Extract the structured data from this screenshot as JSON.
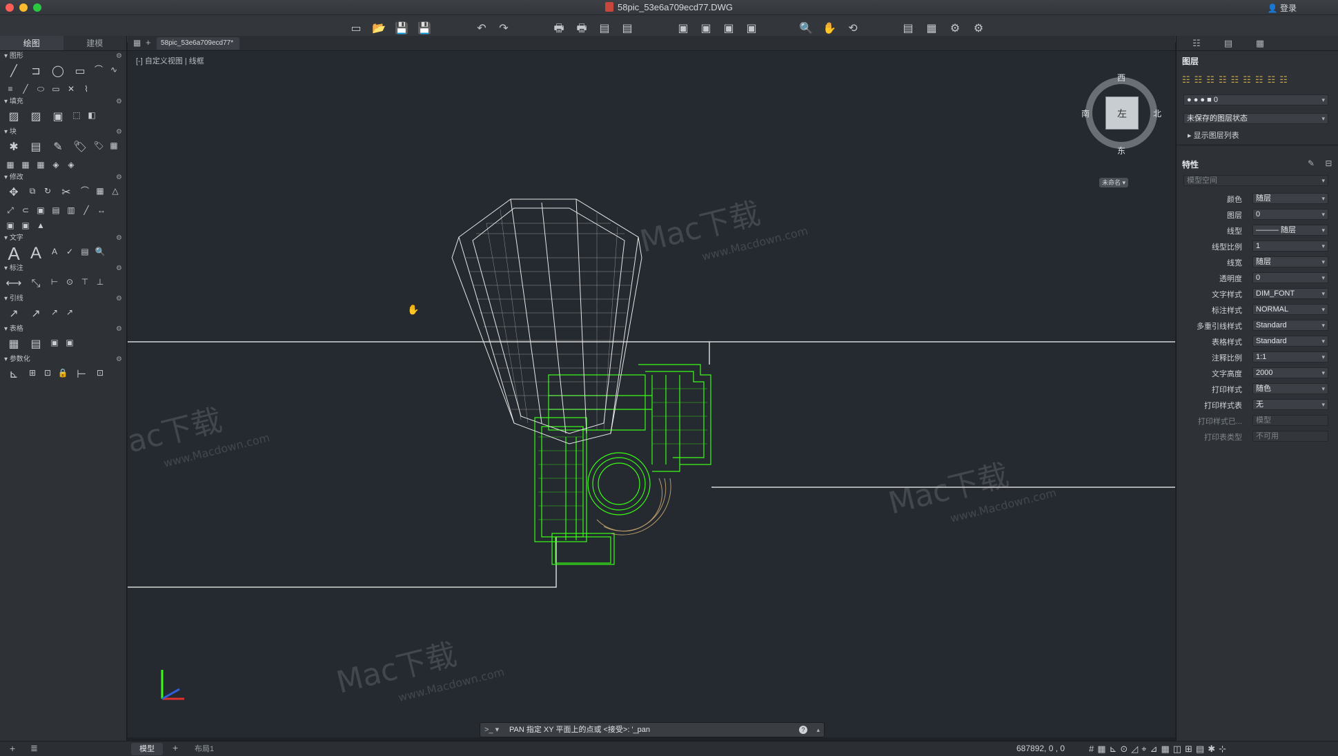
{
  "window": {
    "title": "58pic_53e6a709ecd77.DWG",
    "login": "登录"
  },
  "left_panel": {
    "tabs": [
      "绘图",
      "建模"
    ],
    "sections": [
      "图形",
      "填充",
      "块",
      "修改",
      "文字",
      "标注",
      "引线",
      "表格",
      "参数化"
    ]
  },
  "document": {
    "tab": "58pic_53e6a709ecd77*",
    "view_label": "[-] 自定义视图 | 线框"
  },
  "viewcube": {
    "face": "左",
    "north": "西",
    "east": "北",
    "south": "东",
    "west": "南",
    "unnamed": "未命名"
  },
  "command": {
    "prompt": ">_ ▾",
    "text": "PAN 指定 XY 平面上的点或 <接受>: '_pan",
    "help": "?"
  },
  "status": {
    "tabs": [
      "模型",
      "布局1"
    ],
    "coords": "687892, 0     , 0"
  },
  "layers": {
    "title": "图层",
    "current": "0",
    "state": "未保存的图层状态",
    "show_list": "显示图层列表"
  },
  "properties": {
    "title": "特性",
    "space": "模型空间",
    "rows": [
      {
        "label": "颜色",
        "value": "随层"
      },
      {
        "label": "图层",
        "value": "0"
      },
      {
        "label": "线型",
        "value": "———  随层"
      },
      {
        "label": "线型比例",
        "value": "1"
      },
      {
        "label": "线宽",
        "value": "随层"
      },
      {
        "label": "透明度",
        "value": "0"
      },
      {
        "label": "文字样式",
        "value": "DIM_FONT"
      },
      {
        "label": "标注样式",
        "value": "NORMAL"
      },
      {
        "label": "多重引线样式",
        "value": "Standard"
      },
      {
        "label": "表格样式",
        "value": "Standard"
      },
      {
        "label": "注释比例",
        "value": "1:1"
      },
      {
        "label": "文字高度",
        "value": "2000"
      },
      {
        "label": "打印样式",
        "value": "随色"
      },
      {
        "label": "打印样式表",
        "value": "无"
      },
      {
        "label": "打印样式已...",
        "value": "模型"
      },
      {
        "label": "打印表类型",
        "value": "不可用"
      }
    ]
  },
  "watermark": {
    "brand": "Mac下载",
    "url": "www.Macdown.com"
  },
  "colors": {
    "canvas": "#252a30",
    "panel": "#2e3237",
    "green_wire": "#39ff14",
    "white_wire": "#e8e8e8"
  }
}
